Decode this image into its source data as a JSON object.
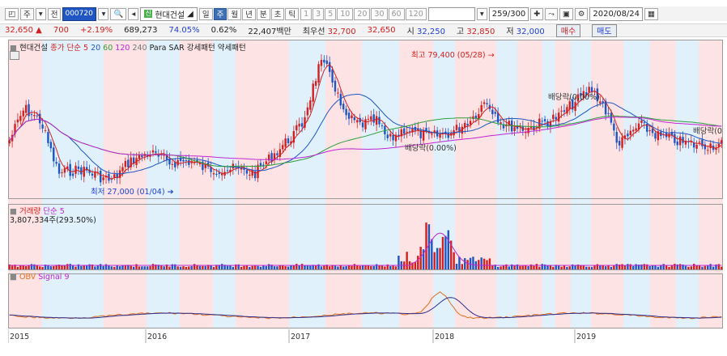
{
  "toolbar": {
    "menu_glyph": "주",
    "prev_glyph": "전",
    "code": "000720",
    "stock_name": "현대건설",
    "periods": [
      "일",
      "주",
      "월",
      "년",
      "분",
      "초",
      "틱"
    ],
    "selected_period": "주",
    "intervals": [
      "1",
      "3",
      "5",
      "10",
      "20",
      "30",
      "60",
      "120"
    ],
    "count": "259/300",
    "date": "2020/08/24"
  },
  "quote": {
    "price": "32,650",
    "change": "700",
    "change_pct": "+2.19%",
    "volume": "689,273",
    "vol_ratio": "74.05%",
    "turnover": "0.62%",
    "amount": "22,407백만",
    "best_ask_label": "최우선",
    "best_ask": "32,700",
    "best_bid": "32,650",
    "open_label": "시",
    "open": "32,250",
    "high_label": "고",
    "high": "32,850",
    "low_label": "저",
    "low": "32,000",
    "buy_label": "매수",
    "sell_label": "매도"
  },
  "price_pane": {
    "legend": [
      {
        "text": "현대건설",
        "color": "#222222"
      },
      {
        "text": "종가 단순",
        "color": "#d21f1f"
      },
      {
        "text": "5",
        "color": "#d21f1f"
      },
      {
        "text": "20",
        "color": "#1f56c4"
      },
      {
        "text": "60",
        "color": "#2c9e3a"
      },
      {
        "text": "120",
        "color": "#c026d3"
      },
      {
        "text": "240",
        "color": "#777777"
      },
      {
        "text": "Para SAR 강세패턴 약세패턴",
        "color": "#222222"
      }
    ],
    "annotations": {
      "high": "최고 79,400 (05/28)",
      "low": "최저 27,000 (01/04)",
      "div1": "배당락(0.00%)",
      "div2": "배당락(0.00%)",
      "div3": "배당락(0"
    }
  },
  "volume_pane": {
    "legend_title": "거래량",
    "legend_ma": "단순 5",
    "current": "3,807,334주(293.50%)"
  },
  "obv_pane": {
    "legend_title": "OBV",
    "legend_signal": "Signal 9"
  },
  "x_axis": {
    "labels": [
      "2015",
      "2016",
      "2017",
      "2018",
      "2019"
    ]
  },
  "chart_data": {
    "type": "candlestick",
    "x": [
      "2015",
      "2016",
      "2017",
      "2018",
      "2019"
    ],
    "price_range": [
      27000,
      79400
    ],
    "annotations": [
      {
        "label": "최고 79,400 (05/28)",
        "value": 79400
      },
      {
        "label": "최저 27,000 (01/04)",
        "value": 27000
      }
    ]
  },
  "colors": {
    "up": "#d21f1f",
    "down": "#1f56c4",
    "band_pink": "#fde3e3",
    "band_blue": "#e0f1fb"
  }
}
